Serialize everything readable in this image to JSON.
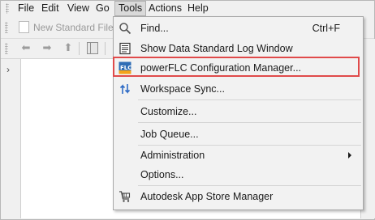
{
  "menubar": {
    "items": [
      "File",
      "Edit",
      "View",
      "Go",
      "Tools",
      "Actions",
      "Help"
    ],
    "active": "Tools"
  },
  "toolbar": {
    "new_file_label": "New Standard File"
  },
  "tools_menu": {
    "items": [
      {
        "label": "Find...",
        "shortcut": "Ctrl+F",
        "icon": "magnifier-icon"
      },
      {
        "label": "Show Data Standard Log Window",
        "icon": "log-window-icon"
      },
      {
        "label": "powerFLC Configuration Manager...",
        "icon": "powerflc-icon",
        "highlighted": true
      },
      {
        "label": "Workspace Sync...",
        "icon": "workspace-sync-icon"
      },
      {
        "label": "Customize..."
      },
      {
        "label": "Job Queue..."
      },
      {
        "label": "Administration",
        "submenu": true
      },
      {
        "label": "Options..."
      },
      {
        "label": "Autodesk App Store Manager",
        "icon": "app-store-cart-icon"
      }
    ]
  },
  "colors": {
    "highlight_border": "#e04a4a",
    "menu_background": "#f2f2f2",
    "window_background": "#f0f0f0"
  }
}
